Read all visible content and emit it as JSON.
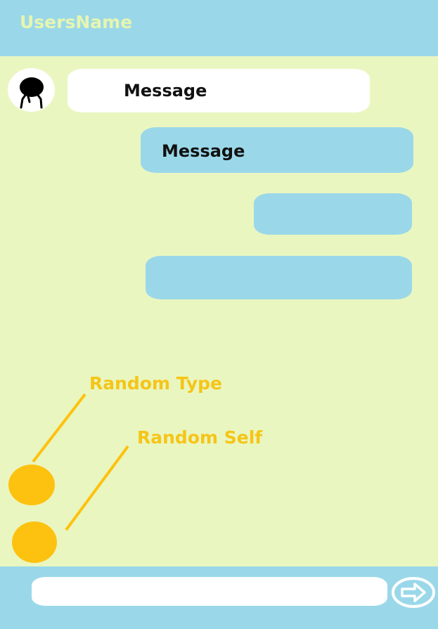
{
  "header": {
    "title": "UsersName"
  },
  "messages": [
    {
      "side": "received",
      "text": "Message"
    },
    {
      "side": "sent",
      "text": "Message"
    },
    {
      "side": "sent",
      "text": ""
    },
    {
      "side": "sent",
      "text": ""
    }
  ],
  "annotations": {
    "random_type": "Random Type",
    "random_self": "Random Self"
  },
  "composer": {
    "value": "",
    "send_icon": "arrow-right-icon"
  },
  "colors": {
    "background": "#eaf6c0",
    "header": "#9ad8e9",
    "header_title": "#e6f5b0",
    "sent_bubble": "#9ad8e9",
    "received_bubble": "#ffffff",
    "accent": "#fdc20f"
  }
}
